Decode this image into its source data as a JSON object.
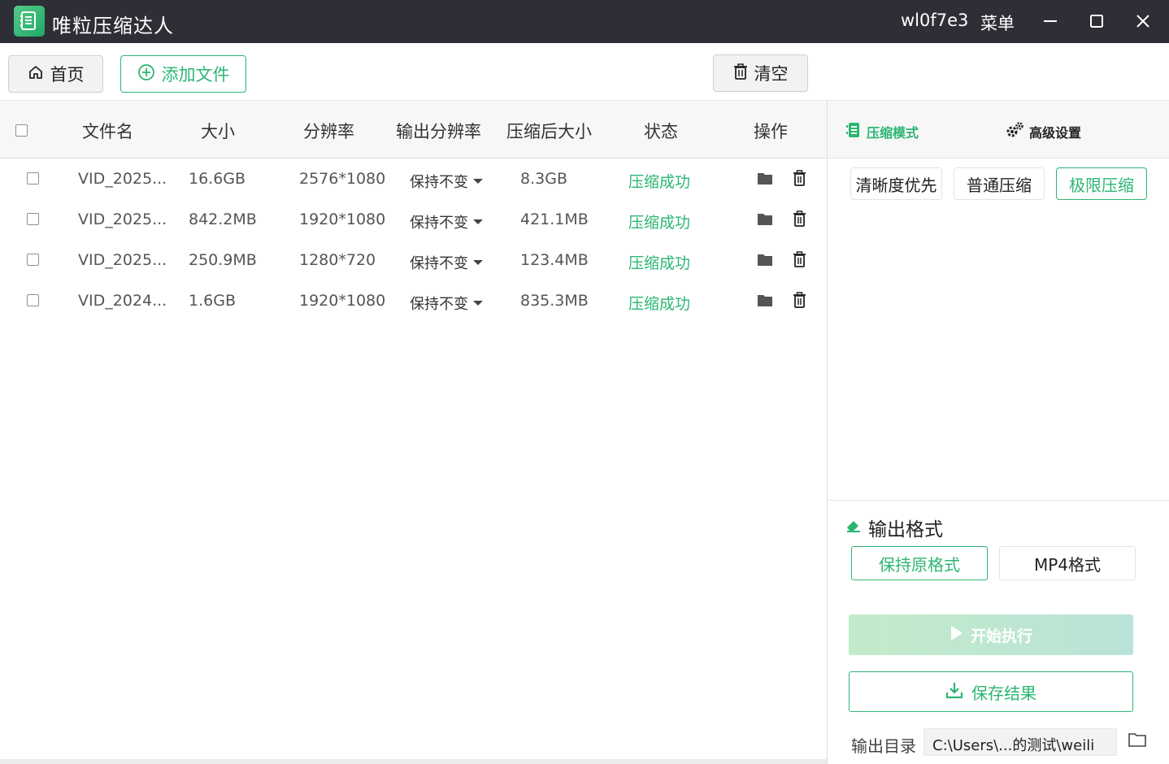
{
  "titlebar": {
    "app_title": "唯粒压缩达人",
    "user_name": "wl0f7e3",
    "menu_label": "菜单"
  },
  "toolbar": {
    "home_label": "首页",
    "add_label": "添加文件",
    "clear_label": "清空"
  },
  "table": {
    "headers": {
      "name": "文件名",
      "size": "大小",
      "resolution": "分辨率",
      "output_resolution": "输出分辨率",
      "compressed_size": "压缩后大小",
      "status": "状态",
      "ops": "操作"
    },
    "rows": [
      {
        "name": "VID_2025...",
        "size": "16.6GB",
        "resolution": "2576*1080",
        "output_resolution": "保持不变",
        "compressed_size": "8.3GB",
        "status": "压缩成功"
      },
      {
        "name": "VID_2025...",
        "size": "842.2MB",
        "resolution": "1920*1080",
        "output_resolution": "保持不变",
        "compressed_size": "421.1MB",
        "status": "压缩成功"
      },
      {
        "name": "VID_2025...",
        "size": "250.9MB",
        "resolution": "1280*720",
        "output_resolution": "保持不变",
        "compressed_size": "123.4MB",
        "status": "压缩成功"
      },
      {
        "name": "VID_2024...",
        "size": "1.6GB",
        "resolution": "1920*1080",
        "output_resolution": "保持不变",
        "compressed_size": "835.3MB",
        "status": "压缩成功"
      }
    ]
  },
  "panel": {
    "tabs": {
      "mode": "压缩模式",
      "advanced": "高级设置"
    },
    "modes": [
      "清晰度优先",
      "普通压缩",
      "极限压缩"
    ],
    "active_mode": "极限压缩",
    "format_title": "输出格式",
    "formats": [
      "保持原格式",
      "MP4格式"
    ],
    "active_format": "保持原格式",
    "start_label": "开始执行",
    "save_label": "保存结果",
    "output_dir_label": "输出目录",
    "output_dir_value": "C:\\Users\\...的测试\\weili"
  },
  "colors": {
    "accent": "#2cb673",
    "titlebar_bg": "#2e2f36"
  }
}
